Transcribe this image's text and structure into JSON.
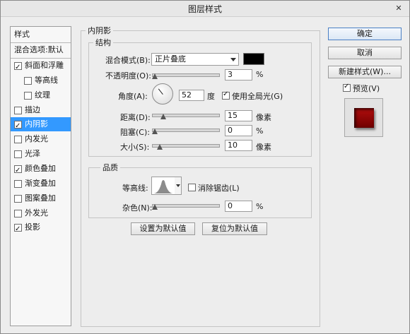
{
  "window": {
    "title": "图层样式",
    "close_icon": "close-icon"
  },
  "sidebar": {
    "items": [
      {
        "label": "样式",
        "checkbox": false,
        "checked": false,
        "selected": false
      },
      {
        "label": "混合选项:默认",
        "checkbox": false,
        "checked": false,
        "selected": false
      },
      {
        "label": "斜面和浮雕",
        "checkbox": true,
        "checked": true,
        "selected": false
      },
      {
        "label": "等高线",
        "checkbox": true,
        "checked": false,
        "selected": false,
        "indent": true
      },
      {
        "label": "纹理",
        "checkbox": true,
        "checked": false,
        "selected": false,
        "indent": true
      },
      {
        "label": "描边",
        "checkbox": true,
        "checked": false,
        "selected": false
      },
      {
        "label": "内阴影",
        "checkbox": true,
        "checked": true,
        "selected": true
      },
      {
        "label": "内发光",
        "checkbox": true,
        "checked": false,
        "selected": false
      },
      {
        "label": "光泽",
        "checkbox": true,
        "checked": false,
        "selected": false
      },
      {
        "label": "颜色叠加",
        "checkbox": true,
        "checked": true,
        "selected": false
      },
      {
        "label": "渐变叠加",
        "checkbox": true,
        "checked": false,
        "selected": false
      },
      {
        "label": "图案叠加",
        "checkbox": true,
        "checked": false,
        "selected": false
      },
      {
        "label": "外发光",
        "checkbox": true,
        "checked": false,
        "selected": false
      },
      {
        "label": "投影",
        "checkbox": true,
        "checked": true,
        "selected": false
      }
    ]
  },
  "panel": {
    "title": "内阴影",
    "structure": {
      "title": "结构",
      "blend_mode_label": "混合模式(B):",
      "blend_mode_value": "正片叠底",
      "blend_color": "#000000",
      "opacity_label": "不透明度(O):",
      "opacity_value": "3",
      "opacity_unit": "%",
      "opacity_fraction": 0.03,
      "angle_label": "角度(A):",
      "angle_value": "52",
      "angle_unit": "度",
      "global_light_label": "使用全局光(G)",
      "global_light_checked": true,
      "distance_label": "距离(D):",
      "distance_value": "15",
      "distance_unit": "像素",
      "choke_label": "阻塞(C):",
      "choke_value": "0",
      "choke_unit": "%",
      "size_label": "大小(S):",
      "size_value": "10",
      "size_unit": "像素"
    },
    "quality": {
      "title": "品质",
      "contour_label": "等高线:",
      "anti_alias_label": "消除锯齿(L)",
      "anti_alias_checked": false,
      "noise_label": "杂色(N):",
      "noise_value": "0",
      "noise_unit": "%"
    },
    "set_default_label": "设置为默认值",
    "reset_default_label": "复位为默认值"
  },
  "actions": {
    "ok_label": "确定",
    "cancel_label": "取消",
    "new_style_label": "新建样式(W)...",
    "preview_label": "预览(V)",
    "preview_checked": true,
    "preview_color": "#8b0000"
  }
}
